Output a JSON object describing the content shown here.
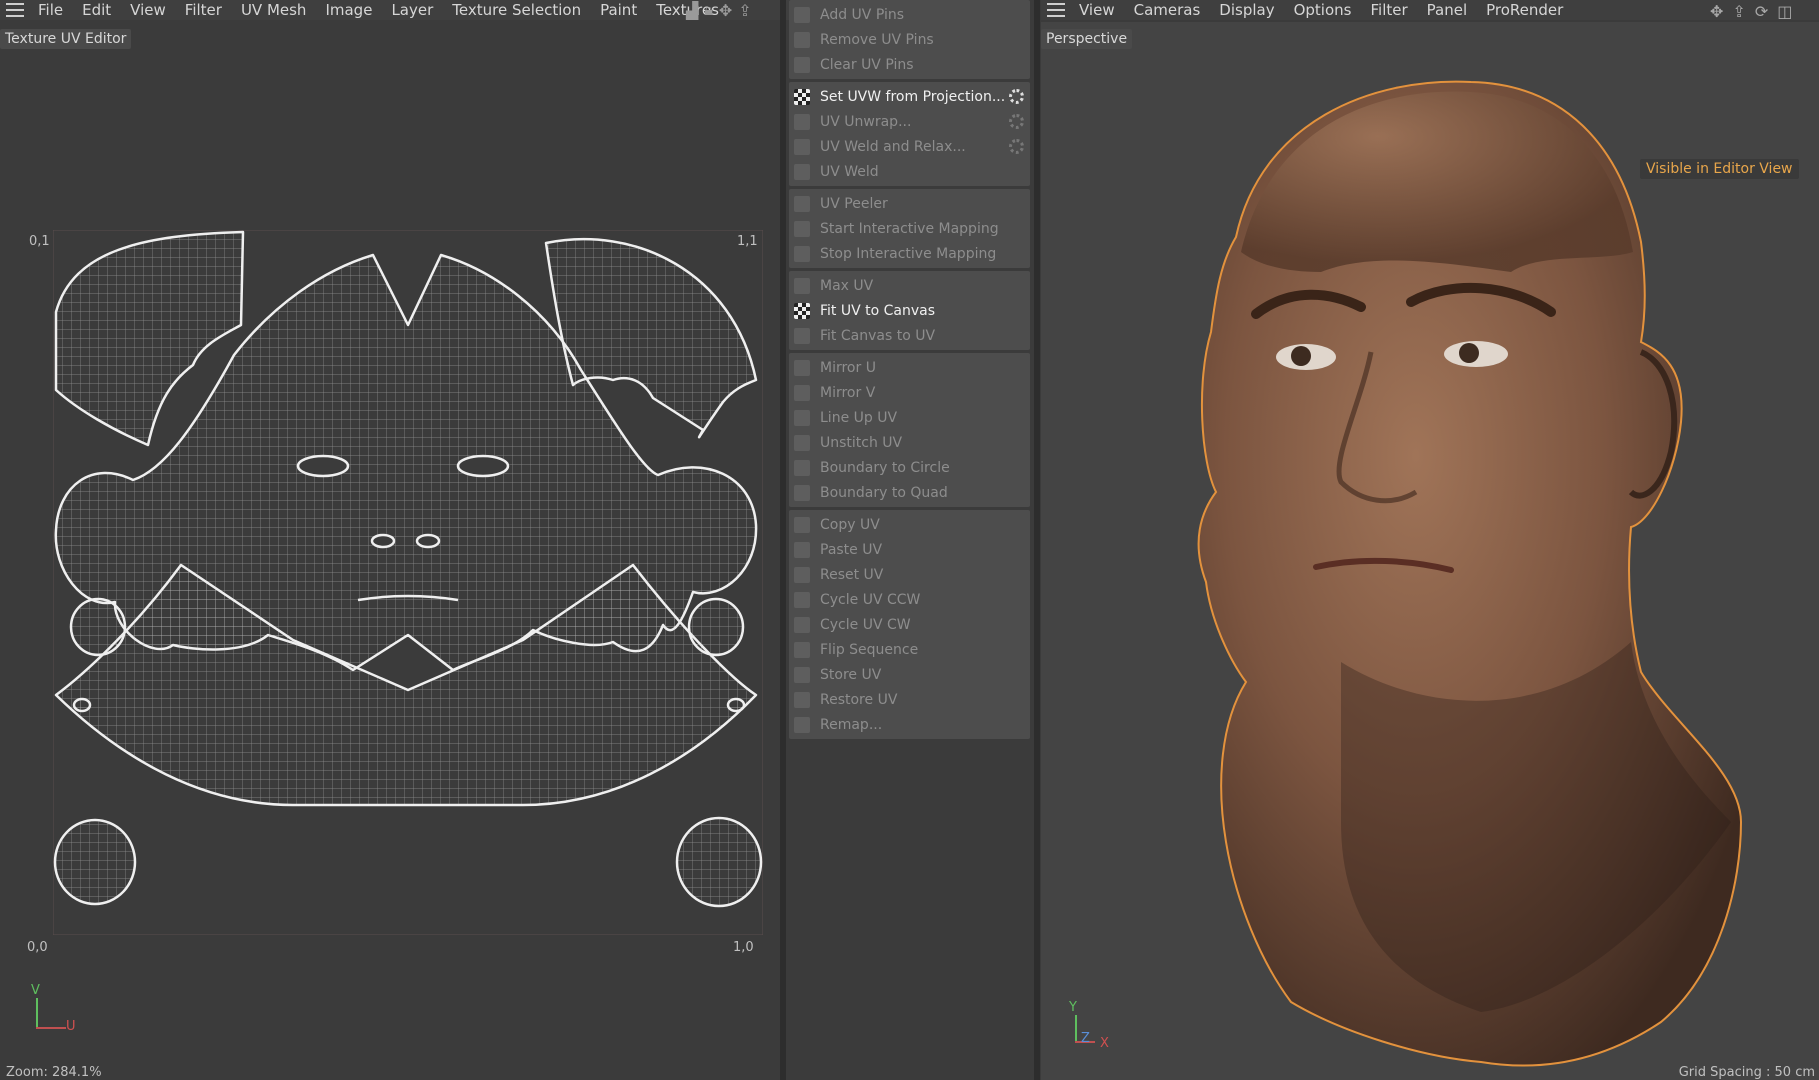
{
  "left_menubar": {
    "items": [
      "File",
      "Edit",
      "View",
      "Filter",
      "UV Mesh",
      "Image",
      "Layer",
      "Texture Selection",
      "Paint",
      "Textures"
    ]
  },
  "uv_editor": {
    "title": "Texture UV Editor",
    "corner_top_left": "0,1",
    "corner_top_right": "1,1",
    "corner_bottom_left": "0,0",
    "corner_bottom_right": "1,0",
    "axis_v": "V",
    "axis_u": "U",
    "footer": "Zoom: 284.1%"
  },
  "uv_commands": {
    "groups": [
      [
        {
          "label": "Add UV Pins"
        },
        {
          "label": "Remove UV Pins"
        },
        {
          "label": "Clear UV Pins"
        }
      ],
      [
        {
          "label": "Set UVW from Projection...",
          "active": true,
          "settings": true
        },
        {
          "label": "UV Unwrap...",
          "settings": true
        },
        {
          "label": "UV Weld and Relax...",
          "settings": true
        },
        {
          "label": "UV Weld"
        }
      ],
      [
        {
          "label": "UV Peeler"
        },
        {
          "label": "Start Interactive Mapping"
        },
        {
          "label": "Stop Interactive Mapping"
        }
      ],
      [
        {
          "label": "Max UV"
        },
        {
          "label": "Fit UV to Canvas",
          "active": true
        },
        {
          "label": "Fit Canvas to UV"
        }
      ],
      [
        {
          "label": "Mirror U"
        },
        {
          "label": "Mirror V"
        },
        {
          "label": "Line Up UV"
        },
        {
          "label": "Unstitch UV"
        },
        {
          "label": "Boundary to Circle"
        },
        {
          "label": "Boundary to Quad"
        }
      ],
      [
        {
          "label": "Copy UV"
        },
        {
          "label": "Paste UV"
        },
        {
          "label": "Reset UV"
        },
        {
          "label": "Cycle UV CCW"
        },
        {
          "label": "Cycle UV CW"
        },
        {
          "label": "Flip Sequence"
        },
        {
          "label": "Store UV"
        },
        {
          "label": "Restore UV"
        },
        {
          "label": "Remap..."
        }
      ]
    ]
  },
  "right_menubar": {
    "items": [
      "View",
      "Cameras",
      "Display",
      "Options",
      "Filter",
      "Panel",
      "ProRender"
    ]
  },
  "viewport": {
    "title": "Perspective",
    "badge": "Visible in Editor View",
    "axis_y": "Y",
    "axis_z": "Z",
    "axis_x": "X",
    "footer": "Grid Spacing : 50 cm"
  },
  "colors": {
    "badge_text": "#e8a64b",
    "object_outline": "#e3923d",
    "skin": "#8a5f45"
  }
}
